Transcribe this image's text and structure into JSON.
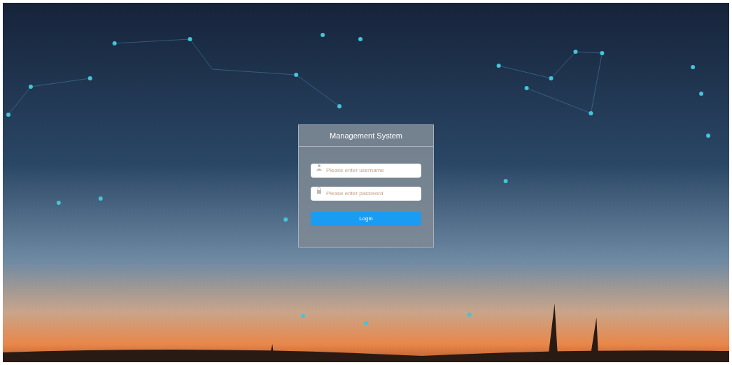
{
  "login": {
    "title": "Management System",
    "fields": [
      {
        "kind": "user",
        "placeholder": "Please enter username"
      },
      {
        "kind": "lock",
        "placeholder": "Please enter password"
      }
    ],
    "button": "Login"
  }
}
